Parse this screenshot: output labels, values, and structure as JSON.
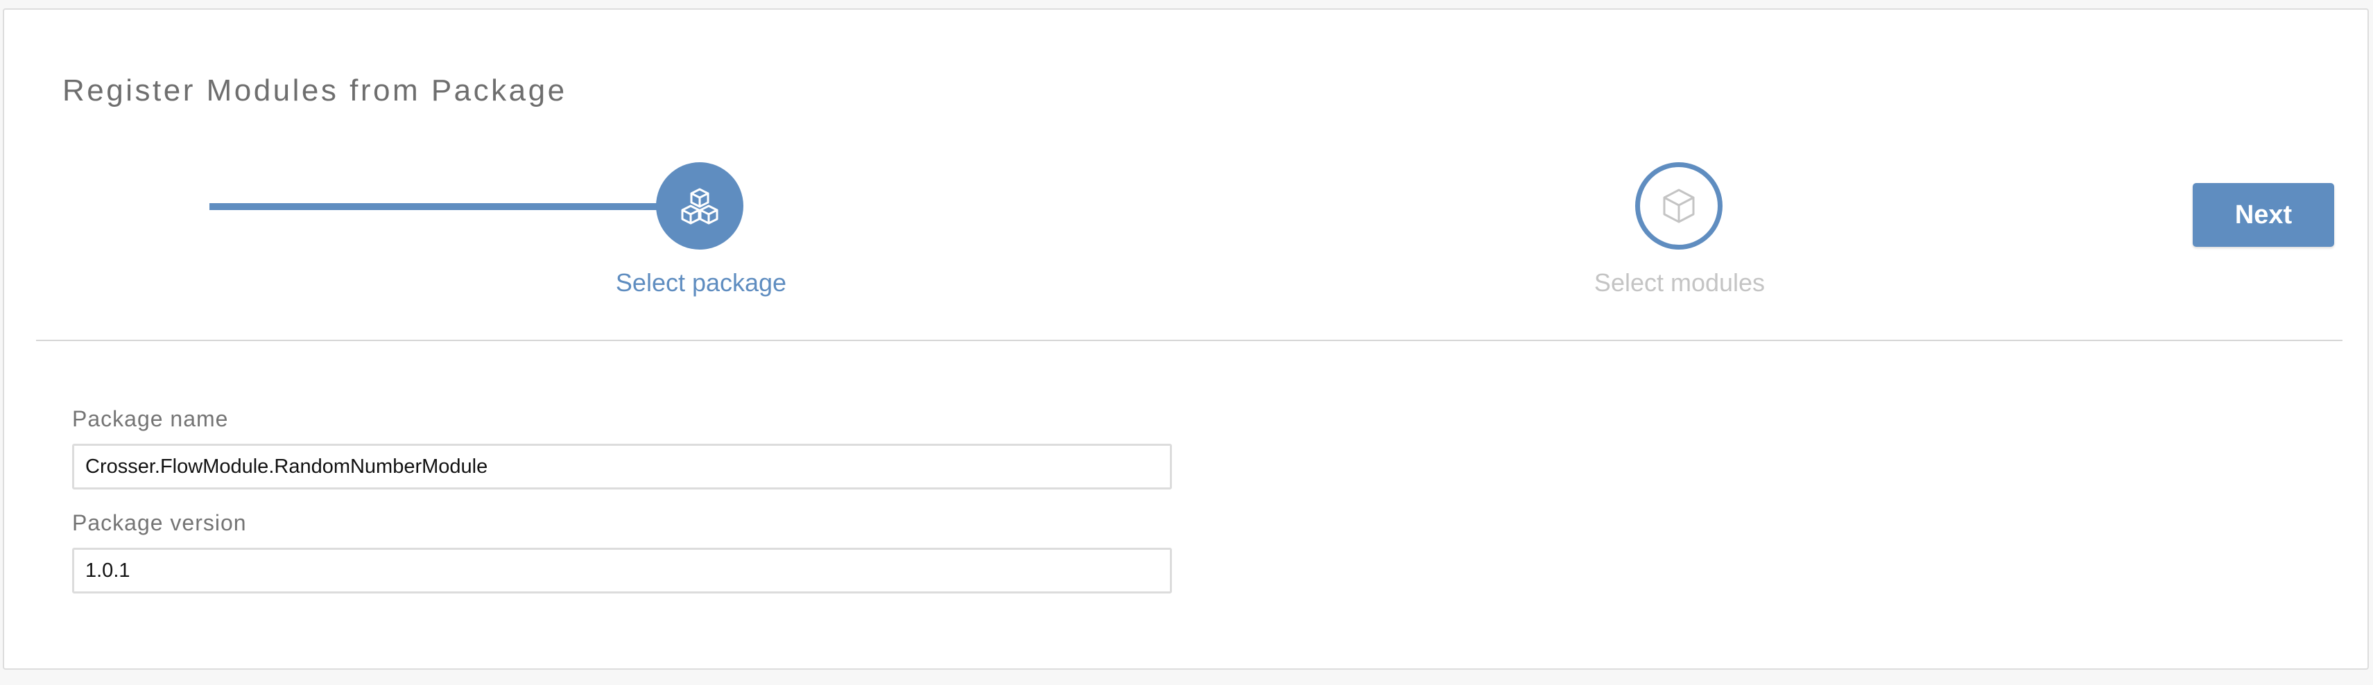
{
  "page": {
    "title": "Register Modules from Package"
  },
  "stepper": {
    "steps": [
      {
        "label": "Select package",
        "icon": "packages-icon",
        "state": "active"
      },
      {
        "label": "Select modules",
        "icon": "cube-icon",
        "state": "inactive"
      }
    ]
  },
  "toolbar": {
    "next_label": "Next"
  },
  "form": {
    "package_name": {
      "label": "Package name",
      "value": "Crosser.FlowModule.RandomNumberModule"
    },
    "package_version": {
      "label": "Package version",
      "value": "1.0.1"
    }
  },
  "colors": {
    "accent": "#5f8dc0",
    "inactive_text": "#c4c4c4",
    "label_text": "#747474"
  }
}
